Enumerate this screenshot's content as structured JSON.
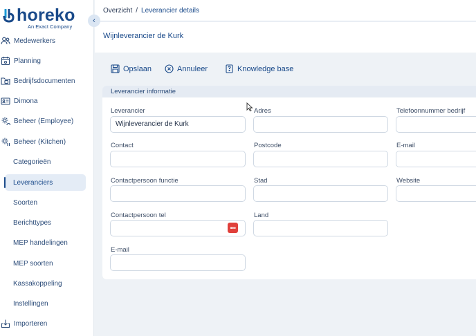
{
  "brand": {
    "name": "horeko",
    "tagline": "An Exact Company",
    "color": "#1a4a8a",
    "accent": "#1a9ad6"
  },
  "sidebar": {
    "items": [
      {
        "label": "Medewerkers",
        "icon": "users-icon"
      },
      {
        "label": "Planning",
        "icon": "calendar-icon"
      },
      {
        "label": "Bedrijfsdocumenten",
        "icon": "folder-icon"
      },
      {
        "label": "Dimona",
        "icon": "id-card-icon"
      },
      {
        "label": "Beheer (Employee)",
        "icon": "gear-users-icon"
      },
      {
        "label": "Beheer (Kitchen)",
        "icon": "gear-kitchen-icon"
      }
    ],
    "sub_items": [
      {
        "label": "Categorieën"
      },
      {
        "label": "Leveranciers",
        "active": true
      },
      {
        "label": "Soorten"
      },
      {
        "label": "Berichttypes"
      },
      {
        "label": "MEP handelingen"
      },
      {
        "label": "MEP soorten"
      },
      {
        "label": "Kassakoppeling"
      },
      {
        "label": "Instellingen"
      }
    ],
    "bottom_item": {
      "label": "Importeren",
      "icon": "import-icon"
    }
  },
  "breadcrumb": {
    "root": "Overzicht",
    "separator": "/",
    "current": "Leverancier details"
  },
  "page_title": "Wijnleverancier de Kurk",
  "toolbar": {
    "save": "Opslaan",
    "cancel": "Annuleer",
    "kb": "Knowledge base"
  },
  "card": {
    "title": "Leverancier informatie",
    "fields": {
      "leverancier": {
        "label": "Leverancier",
        "value": "Wijnleverancier de Kurk"
      },
      "adres": {
        "label": "Adres",
        "value": ""
      },
      "telefoon": {
        "label": "Telefoonnummer bedrijf",
        "value": ""
      },
      "contact": {
        "label": "Contact",
        "value": ""
      },
      "postcode": {
        "label": "Postcode",
        "value": ""
      },
      "email_right": {
        "label": "E-mail",
        "value": ""
      },
      "functie": {
        "label": "Contactpersoon functie",
        "value": ""
      },
      "stad": {
        "label": "Stad",
        "value": ""
      },
      "website": {
        "label": "Website",
        "value": ""
      },
      "tel": {
        "label": "Contactpersoon tel",
        "value": ""
      },
      "land": {
        "label": "Land",
        "value": ""
      },
      "email_left": {
        "label": "E-mail",
        "value": ""
      }
    }
  }
}
